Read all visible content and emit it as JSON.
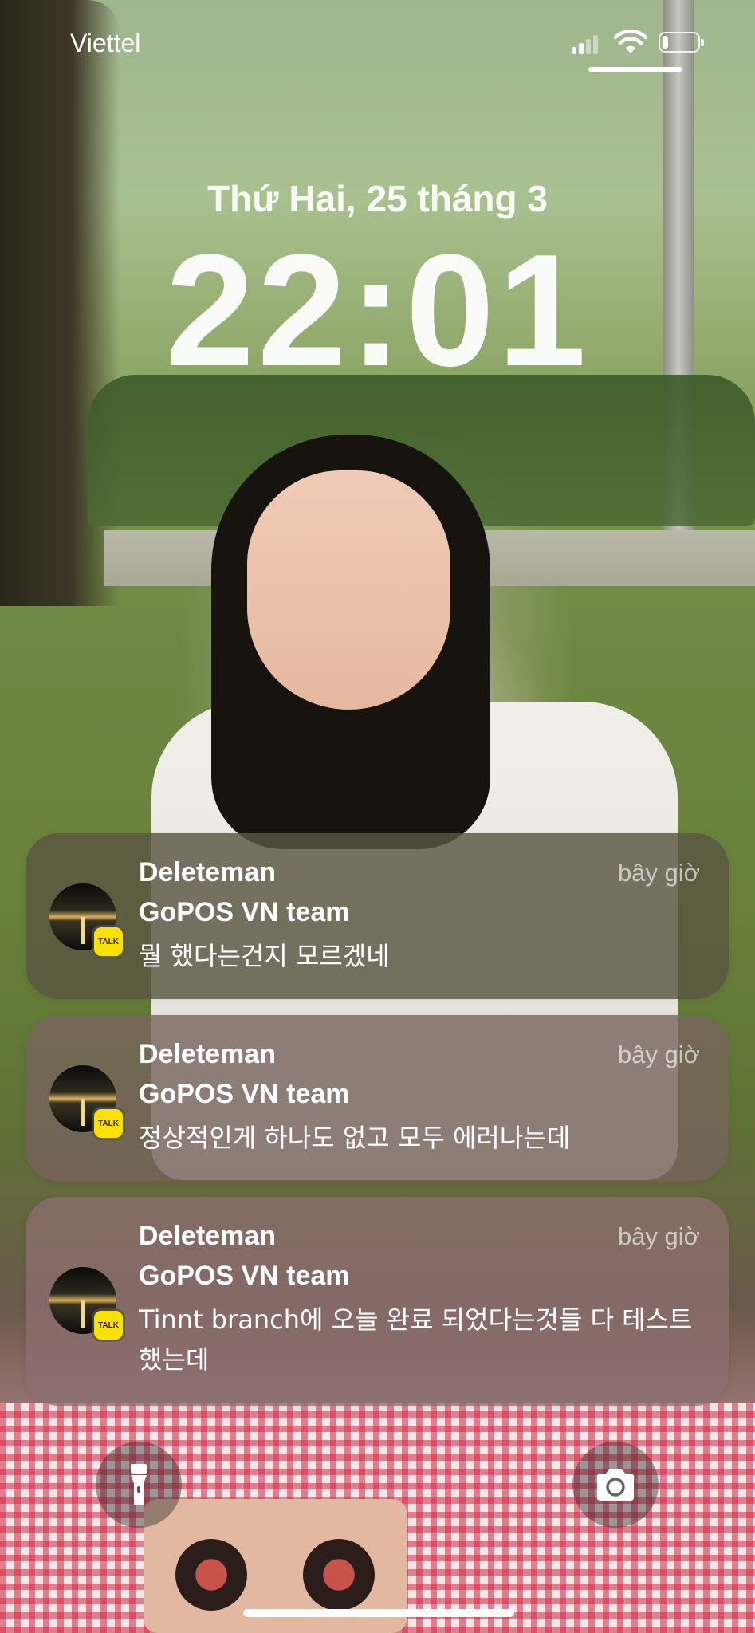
{
  "status_bar": {
    "carrier": "Viettel",
    "battery_level": 0.18,
    "icons": [
      "signal-icon",
      "wifi-icon",
      "battery-icon"
    ]
  },
  "lock_screen": {
    "date": "Thứ Hai, 25 tháng 3",
    "time": "22:01"
  },
  "notifications": [
    {
      "app_icon": "kakaotalk-icon",
      "badge_text": "TALK",
      "sender": "Deleteman",
      "group": "GoPOS VN team",
      "time": "bây giờ",
      "message": "뭘 했다는건지 모르겠네"
    },
    {
      "app_icon": "kakaotalk-icon",
      "badge_text": "TALK",
      "sender": "Deleteman",
      "group": "GoPOS VN team",
      "time": "bây giờ",
      "message": "정상적인게 하나도 없고 모두 에러나는데"
    },
    {
      "app_icon": "kakaotalk-icon",
      "badge_text": "TALK",
      "sender": "Deleteman",
      "group": "GoPOS VN team",
      "time": "bây giờ",
      "message": "Tinnt branch에 오늘 완료 되었다는것들 다 테스트 했는데"
    }
  ],
  "quick_actions": {
    "left": "flashlight-icon",
    "right": "camera-icon"
  },
  "colors": {
    "badge": "#fae100",
    "text": "#ffffff"
  }
}
